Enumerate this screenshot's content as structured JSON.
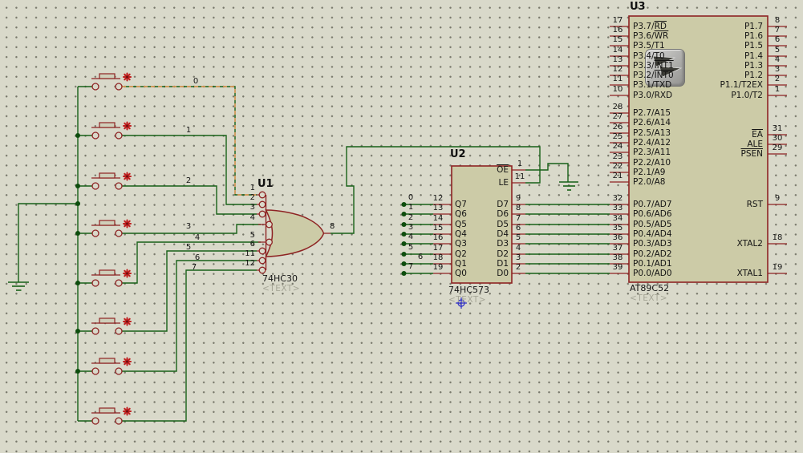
{
  "app": {
    "type": "schematic-capture-canvas"
  },
  "colors": {
    "background": "#d9d9ca",
    "grid_dot": "#77776a",
    "wire_green": "#176117",
    "pin_red": "#8e2323",
    "chip_fill": "#cccba7",
    "highlight_dash": "#ee9955",
    "junction_dot": "#0d4d0d",
    "button_marker_red": "#c01f1f",
    "origin_marker_blue": "#2a2ac8",
    "text": "#141414",
    "placeholder_text": "#a6a697"
  },
  "icons": {
    "overlay_button": "double-down-arrows-icon",
    "origin_marker": "crosshair-icon",
    "button_actuator": "red-star-icon"
  },
  "nets": {
    "buttons": [
      "0",
      "1",
      "2",
      "3",
      "4",
      "5",
      "6",
      "7"
    ],
    "latch": [
      "0",
      "1",
      "2",
      "3",
      "4",
      "5",
      "6",
      "7"
    ]
  },
  "u1": {
    "ref": "U1",
    "part": "74HC30",
    "placeholder": "<TEXT>",
    "pin_numbers": [
      "1",
      "2",
      "3",
      "4",
      "5",
      "6",
      "11",
      "12"
    ],
    "output_number": "8"
  },
  "u2": {
    "ref": "U2",
    "part": "74HC573",
    "placeholder": "<TEXT>",
    "oe": {
      "num": "1",
      "pre": "",
      "ol": "OE"
    },
    "le": {
      "num": "11",
      "pre": "LE",
      "ol": ""
    },
    "q_pins": [
      {
        "name": "Q7",
        "num": "12"
      },
      {
        "name": "Q6",
        "num": "13"
      },
      {
        "name": "Q5",
        "num": "14"
      },
      {
        "name": "Q4",
        "num": "15"
      },
      {
        "name": "Q3",
        "num": "16"
      },
      {
        "name": "Q2",
        "num": "17"
      },
      {
        "name": "Q1",
        "num": "18"
      },
      {
        "name": "Q0",
        "num": "19"
      }
    ],
    "d_pins": [
      {
        "name": "D7",
        "num": "9"
      },
      {
        "name": "D6",
        "num": "8"
      },
      {
        "name": "D5",
        "num": "7"
      },
      {
        "name": "D4",
        "num": "6"
      },
      {
        "name": "D3",
        "num": "5"
      },
      {
        "name": "D2",
        "num": "4"
      },
      {
        "name": "D1",
        "num": "3"
      },
      {
        "name": "D0",
        "num": "2"
      }
    ]
  },
  "u3": {
    "ref": "U3",
    "part": "AT89C52",
    "placeholder": "<TEXT>",
    "p3_pins": [
      {
        "num": "17",
        "pre": "P3.7/",
        "ol": "RD"
      },
      {
        "num": "16",
        "pre": "P3.6/",
        "ol": "WR"
      },
      {
        "num": "15",
        "pre": "P3.5/T1",
        "ol": ""
      },
      {
        "num": "14",
        "pre": "P3.4/T0",
        "ol": ""
      },
      {
        "num": "13",
        "pre": "P3.3/",
        "ol": "INT1"
      },
      {
        "num": "12",
        "pre": "P3.2/",
        "ol": "INT0"
      },
      {
        "num": "11",
        "pre": "P3.1/TXD",
        "ol": ""
      },
      {
        "num": "10",
        "pre": "P3.0/RXD",
        "ol": ""
      }
    ],
    "p2_pins": [
      {
        "num": "28",
        "pre": "P2.7/A15",
        "ol": ""
      },
      {
        "num": "27",
        "pre": "P2.6/A14",
        "ol": ""
      },
      {
        "num": "26",
        "pre": "P2.5/A13",
        "ol": ""
      },
      {
        "num": "25",
        "pre": "P2.4/A12",
        "ol": ""
      },
      {
        "num": "24",
        "pre": "P2.3/A11",
        "ol": ""
      },
      {
        "num": "23",
        "pre": "P2.2/A10",
        "ol": ""
      },
      {
        "num": "22",
        "pre": "P2.1/A9",
        "ol": ""
      },
      {
        "num": "21",
        "pre": "P2.0/A8",
        "ol": ""
      }
    ],
    "p0_pins": [
      {
        "num": "32",
        "pre": "P0.7/AD7",
        "ol": ""
      },
      {
        "num": "33",
        "pre": "P0.6/AD6",
        "ol": ""
      },
      {
        "num": "34",
        "pre": "P0.5/AD5",
        "ol": ""
      },
      {
        "num": "35",
        "pre": "P0.4/AD4",
        "ol": ""
      },
      {
        "num": "36",
        "pre": "P0.3/AD3",
        "ol": ""
      },
      {
        "num": "37",
        "pre": "P0.2/AD2",
        "ol": ""
      },
      {
        "num": "38",
        "pre": "P0.1/AD1",
        "ol": ""
      },
      {
        "num": "39",
        "pre": "P0.0/AD0",
        "ol": ""
      }
    ],
    "p1_pins": [
      {
        "num": "8",
        "pre": "P1.7",
        "ol": ""
      },
      {
        "num": "7",
        "pre": "P1.6",
        "ol": ""
      },
      {
        "num": "6",
        "pre": "P1.5",
        "ol": ""
      },
      {
        "num": "5",
        "pre": "P1.4",
        "ol": ""
      },
      {
        "num": "4",
        "pre": "P1.3",
        "ol": ""
      },
      {
        "num": "3",
        "pre": "P1.2",
        "ol": ""
      },
      {
        "num": "2",
        "pre": "P1.1/T2EX",
        "ol": ""
      },
      {
        "num": "1",
        "pre": "P1.0/T2",
        "ol": ""
      }
    ],
    "ctrl_pins": [
      {
        "num": "31",
        "pre": "",
        "ol": "EA"
      },
      {
        "num": "30",
        "pre": "ALE",
        "ol": ""
      },
      {
        "num": "29",
        "pre": "",
        "ol": "PSEN"
      }
    ],
    "rst": {
      "num": "9",
      "pre": "RST",
      "ol": ""
    },
    "xtal2": {
      "num": "18",
      "pre": "XTAL2",
      "ol": ""
    },
    "xtal1": {
      "num": "19",
      "pre": "XTAL1",
      "ol": ""
    }
  }
}
